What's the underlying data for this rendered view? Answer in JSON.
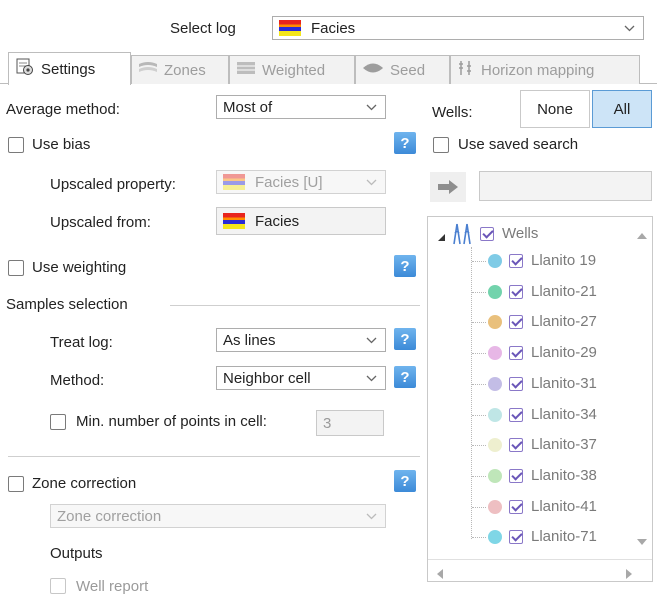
{
  "select_log": {
    "label": "Select log",
    "value": "Facies"
  },
  "tabs": [
    {
      "label": "Settings",
      "active": true
    },
    {
      "label": "Zones",
      "active": false
    },
    {
      "label": "Weighted",
      "active": false
    },
    {
      "label": "Seed",
      "active": false
    },
    {
      "label": "Horizon mapping",
      "active": false
    }
  ],
  "settings": {
    "average_method_label": "Average method:",
    "average_method_value": "Most of",
    "use_bias_label": "Use bias",
    "upscaled_property_label": "Upscaled property:",
    "upscaled_property_value": "Facies [U]",
    "upscaled_from_label": "Upscaled from:",
    "upscaled_from_value": "Facies",
    "use_weighting_label": "Use weighting",
    "samples_selection_label": "Samples selection",
    "treat_log_label": "Treat log:",
    "treat_log_value": "As lines",
    "method_label": "Method:",
    "method_value": "Neighbor cell",
    "min_points_label": "Min. number of points in cell:",
    "min_points_value": "3",
    "zone_correction_label": "Zone correction",
    "zone_correction_value": "Zone correction",
    "outputs_label": "Outputs",
    "well_report_label": "Well report",
    "help_label": "?"
  },
  "wells": {
    "label": "Wells:",
    "none_button": "None",
    "all_button": "All",
    "use_saved_search_label": "Use saved search",
    "tree_root": "Wells",
    "items": [
      {
        "name": "Llanito 19",
        "color": "#7fcbe6"
      },
      {
        "name": "Llanito-21",
        "color": "#72d3ac"
      },
      {
        "name": "Llanito-27",
        "color": "#e9c07c"
      },
      {
        "name": "Llanito-29",
        "color": "#e7b7e6"
      },
      {
        "name": "Llanito-31",
        "color": "#c3bde6"
      },
      {
        "name": "Llanito-34",
        "color": "#bfe6e6"
      },
      {
        "name": "Llanito-37",
        "color": "#eeefcf"
      },
      {
        "name": "Llanito-38",
        "color": "#bfe6b9"
      },
      {
        "name": "Llanito-41",
        "color": "#eebfc2"
      },
      {
        "name": "Llanito-71",
        "color": "#7fd6e6"
      }
    ]
  }
}
